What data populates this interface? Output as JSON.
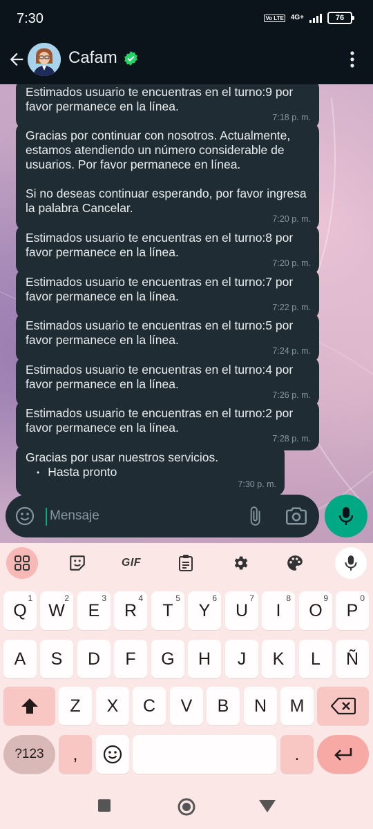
{
  "status_bar": {
    "time": "7:30",
    "volte": "Vo LTE",
    "network": "4G+",
    "battery": "76"
  },
  "header": {
    "title": "Cafam"
  },
  "messages": [
    {
      "text": "Estimados usuario te encuentras en el turno:9 por favor permanece en la línea.",
      "time": "7:18 p. m."
    },
    {
      "text": "Gracias por continuar con nosotros. Actualmente, estamos atendiendo un número considerable de usuarios. Por favor permanece en línea.\n\nSi no deseas continuar esperando, por favor ingresa la palabra Cancelar.",
      "time": "7:20 p. m."
    },
    {
      "text": "Estimados usuario te encuentras en el turno:8 por favor permanece en la línea.",
      "time": "7:20 p. m."
    },
    {
      "text": "Estimados usuario te encuentras en el turno:7 por favor permanece en la línea.",
      "time": "7:22 p. m."
    },
    {
      "text": "Estimados usuario te encuentras en el turno:5 por favor permanece en la línea.",
      "time": "7:24 p. m."
    },
    {
      "text": "Estimados usuario te encuentras en el turno:4 por favor permanece en la línea.",
      "time": "7:26 p. m."
    },
    {
      "text": "Estimados usuario te encuentras en el turno:2 por favor permanece en la línea.",
      "time": "7:28 p. m."
    },
    {
      "text": "Gracias por usar nuestros servicios.",
      "bullet": "Hasta pronto",
      "time": "7:30 p. m."
    }
  ],
  "composer": {
    "placeholder": "Mensaje"
  },
  "keyboard": {
    "toolbar": {
      "gif": "GIF"
    },
    "row1": [
      {
        "label": "Q",
        "hint": "1"
      },
      {
        "label": "W",
        "hint": "2"
      },
      {
        "label": "E",
        "hint": "3"
      },
      {
        "label": "R",
        "hint": "4"
      },
      {
        "label": "T",
        "hint": "5"
      },
      {
        "label": "Y",
        "hint": "6"
      },
      {
        "label": "U",
        "hint": "7"
      },
      {
        "label": "I",
        "hint": "8"
      },
      {
        "label": "O",
        "hint": "9"
      },
      {
        "label": "P",
        "hint": "0"
      }
    ],
    "row2": [
      "A",
      "S",
      "D",
      "F",
      "G",
      "H",
      "J",
      "K",
      "L",
      "Ñ"
    ],
    "row3": [
      "Z",
      "X",
      "C",
      "V",
      "B",
      "N",
      "M"
    ],
    "symbols": "?123",
    "comma": ",",
    "period": "."
  },
  "colors": {
    "accent": "#00a884",
    "bubble": "#1f2c34",
    "keyboard_bg": "#fbe8e6"
  }
}
